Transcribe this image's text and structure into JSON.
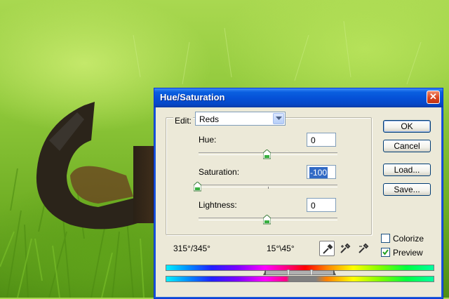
{
  "background": {
    "description_colors": [
      "#a9d850",
      "#4f8e14"
    ]
  },
  "dialog": {
    "title": "Hue/Saturation",
    "close_glyph": "✕",
    "edit": {
      "label": "Edit:",
      "selected": "Reds"
    },
    "hue": {
      "label": "Hue:",
      "value": "0",
      "slider_fraction": 0.5
    },
    "saturation": {
      "label": "Saturation:",
      "value": "-100",
      "slider_fraction": 0.0
    },
    "lightness": {
      "label": "Lightness:",
      "value": "0",
      "slider_fraction": 0.5
    },
    "buttons": {
      "ok": "OK",
      "cancel": "Cancel",
      "load": "Load...",
      "save": "Save..."
    },
    "colorize": {
      "label": "Colorize",
      "checked": false
    },
    "preview": {
      "label": "Preview",
      "checked": true
    },
    "angles": {
      "left": "315°/345°",
      "right": "15°\\45°"
    },
    "tools": [
      "eyedropper-icon",
      "eyedropper-plus-icon",
      "eyedropper-minus-icon"
    ],
    "colors": {
      "title_bar": "#0550d6",
      "dialog_bg": "#ece9d8",
      "selection": "#316ac5"
    }
  }
}
